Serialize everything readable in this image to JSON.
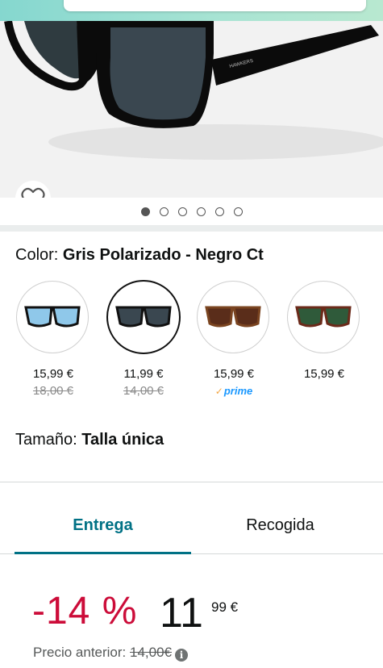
{
  "header": {},
  "gallery": {
    "brand_text": "HAWKERS",
    "image_count": 6,
    "active_index": 0
  },
  "color": {
    "label": "Color: ",
    "selected_value": "Gris Polarizado - Negro Ct",
    "options": [
      {
        "price": "15,99 €",
        "old_price": "18,00 €",
        "prime": false,
        "lens": "#8fc8ea",
        "frame": "#111111"
      },
      {
        "price": "11,99 €",
        "old_price": "14,00 €",
        "prime": false,
        "lens": "#3a4750",
        "frame": "#111111",
        "selected": true
      },
      {
        "price": "15,99 €",
        "old_price": "",
        "prime": true,
        "prime_label": "prime",
        "lens": "#5a2d1a",
        "frame": "#6b3a1f"
      },
      {
        "price": "15,99 €",
        "old_price": "",
        "prime": false,
        "lens": "#2f5a3a",
        "frame": "#6b2a1a"
      }
    ]
  },
  "size": {
    "label": "Tamaño: ",
    "value": "Talla única"
  },
  "tabs": [
    {
      "label": "Entrega",
      "active": true
    },
    {
      "label": "Recogida",
      "active": false
    }
  ],
  "pricing": {
    "discount": "-14 %",
    "whole": "11",
    "fraction": "99 €",
    "previous_label": "Precio anterior: ",
    "previous_value": "14,00€"
  },
  "colors": {
    "accent": "#007185",
    "discount": "#cc0c39",
    "prime": "#1a98ff"
  }
}
